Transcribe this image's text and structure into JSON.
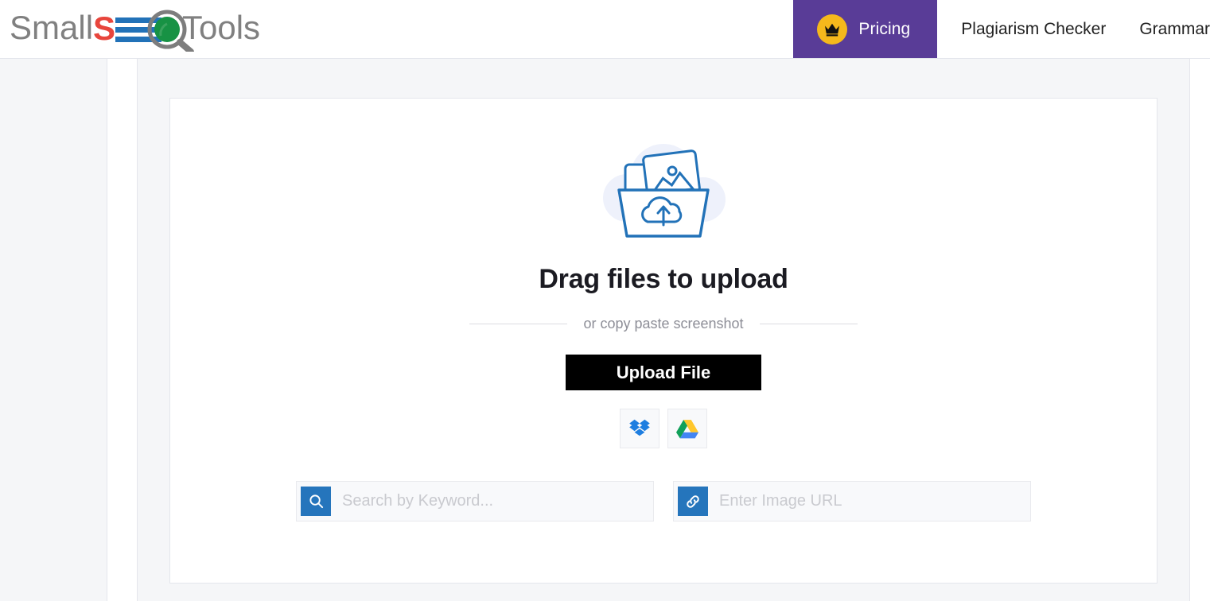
{
  "brand": {
    "name": "SmallSEOTools",
    "part_small": "Small",
    "part_s": "S",
    "part_e": "E",
    "part_o": "O",
    "part_tools": "Tools",
    "colors": {
      "small_gray": "#808080",
      "s_red": "#E8453C",
      "e_blue": "#2272B8",
      "o_green": "#179244",
      "tools_gray": "#808080"
    }
  },
  "header": {
    "pricing": {
      "label": "Pricing",
      "icon": "crown-icon",
      "bg": "#593C97",
      "badge_bg": "#F5B81C"
    },
    "nav_links": [
      {
        "label": "Plagiarism Checker"
      },
      {
        "label": "Grammar"
      }
    ]
  },
  "upload": {
    "illustration_icon": "folder-photos-cloud-upload-icon",
    "title": "Drag files to upload",
    "divider_text": "or copy paste screenshot",
    "button_label": "Upload File",
    "button_bg": "#000000",
    "cloud_services": [
      {
        "name": "dropbox-icon",
        "label": "Dropbox"
      },
      {
        "name": "google-drive-icon",
        "label": "Google Drive"
      }
    ],
    "search_field": {
      "icon": "search-icon",
      "placeholder": "Search by Keyword...",
      "value": "",
      "icon_bg": "#2575BC"
    },
    "url_field": {
      "icon": "link-icon",
      "placeholder": "Enter Image URL",
      "value": "",
      "icon_bg": "#2575BC"
    }
  }
}
